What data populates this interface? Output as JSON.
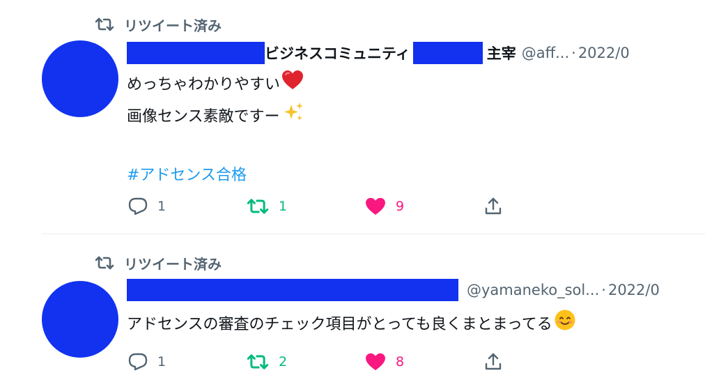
{
  "tweets": [
    {
      "retweet_label": "リツイート済み",
      "name_part1": "ビジネスコミュニティ",
      "name_part2": "主宰",
      "handle": "@aff...",
      "separator": "·",
      "date": "2022/0",
      "text_lines": [
        "めっちゃわかりやすい",
        "画像センス素敵ですー"
      ],
      "hashtag": "#アドセンス合格",
      "reply_count": "1",
      "retweet_count": "1",
      "like_count": "9"
    },
    {
      "retweet_label": "リツイート済み",
      "handle": "@yamaneko_sol...",
      "separator": "·",
      "date": "2022/0",
      "text_lines": [
        "アドセンスの審査のチェック項目がとっても良くまとまってる"
      ],
      "reply_count": "1",
      "retweet_count": "2",
      "like_count": "8"
    }
  ],
  "icons": {
    "retweet": "retweet-icon",
    "reply": "reply-icon",
    "like": "heart-icon",
    "share": "share-icon",
    "emoji_heart": "red-heart-emoji",
    "emoji_sparkles": "sparkles-emoji",
    "emoji_smile": "smiling-face-emoji"
  },
  "colors": {
    "redaction": "#1232f0",
    "hashtag": "#1d9bf0",
    "retweet_green": "#00ba7c",
    "like_pink": "#f91880",
    "muted": "#536471"
  }
}
